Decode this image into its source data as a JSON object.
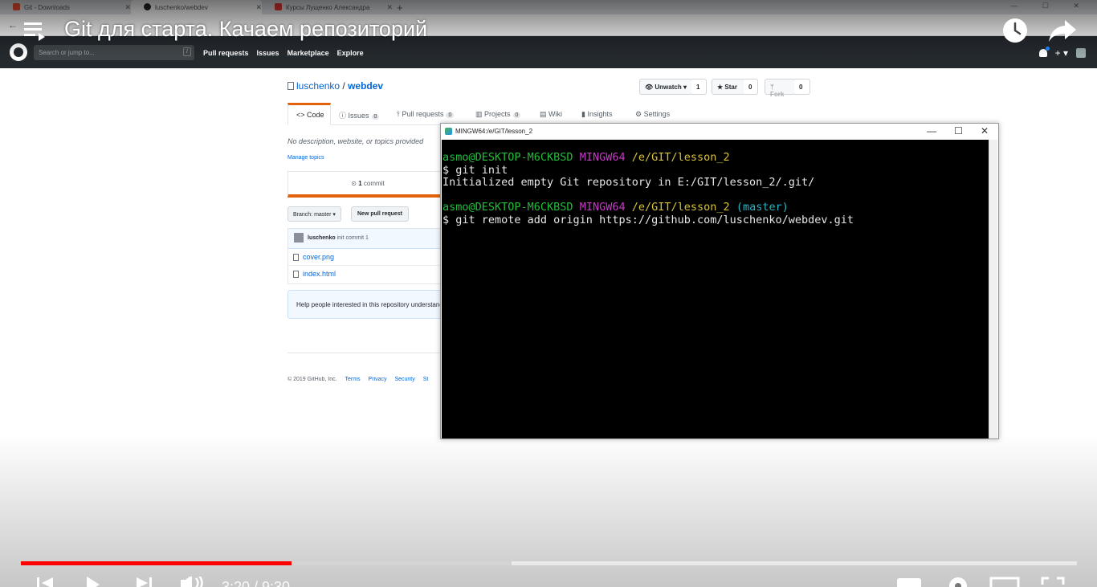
{
  "browser": {
    "tabs": [
      {
        "label": "Git - Downloads",
        "favicon_color": "#f05133"
      },
      {
        "label": "luschenko/webdev",
        "favicon_color": "#24292e"
      },
      {
        "label": "Курсы Лущенко Александра",
        "favicon_color": "#e53935"
      }
    ],
    "new_tab": "+"
  },
  "github": {
    "search_placeholder": "Search or jump to...",
    "search_shortcut": "/",
    "nav": [
      "Pull requests",
      "Issues",
      "Marketplace",
      "Explore"
    ],
    "plus": "+ ▾",
    "repo_owner": "luschenko",
    "repo_sep": "/",
    "repo_name": "webdev",
    "watch_label": "👁 Unwatch ▾",
    "watch_count": "1",
    "star_label": "★ Star",
    "star_count": "0",
    "fork_label": "Fork",
    "fork_count": "0",
    "tabs": {
      "code": "<> Code",
      "issues": "Issues",
      "issues_count": "0",
      "pull_requests": "Pull requests",
      "pull_requests_count": "0",
      "projects": "Projects",
      "projects_count": "0",
      "wiki": "Wiki",
      "insights": "Insights",
      "settings": "Settings"
    },
    "description": "No description, website, or topics provided",
    "manage_topics": "Manage topics",
    "commits_count": "1",
    "commits_label": "commit",
    "branch_button": "Branch: master ▾",
    "new_pr_button": "New pull request",
    "last_commit_author": "luschenko",
    "last_commit_message": "init commit 1",
    "files": [
      "cover.png",
      "index.html"
    ],
    "help_text": "Help people interested in this repository understand your project",
    "footer_copyright": "© 2019 GitHub, Inc.",
    "footer_links": [
      "Terms",
      "Privacy",
      "Security",
      "St"
    ]
  },
  "terminal": {
    "title": "MINGW64:/e/GIT/lesson_2",
    "controls": [
      "—",
      "☐",
      "✕"
    ],
    "lines": [
      {
        "user": "asmo@DESKTOP-M6CKBSD",
        "env": "MINGW64",
        "path": "/e/GIT/lesson_2",
        "branch": ""
      },
      {
        "cmd": "$ git init"
      },
      {
        "out": "Initialized empty Git repository in E:/GIT/lesson_2/.git/"
      },
      {
        "blank": ""
      },
      {
        "user": "asmo@DESKTOP-M6CKBSD",
        "env": "MINGW64",
        "path": "/e/GIT/lesson_2",
        "branch": "(master)"
      },
      {
        "cmd": "$ git remote add origin https://github.com/luschenko/webdev.git"
      }
    ]
  },
  "video": {
    "title": "Git для старта. Качаем репозиторий",
    "time": "3:20 / 9:30",
    "progress_played": 0.256,
    "progress_buffered": 0.465,
    "progress_color": "#ff0000"
  }
}
